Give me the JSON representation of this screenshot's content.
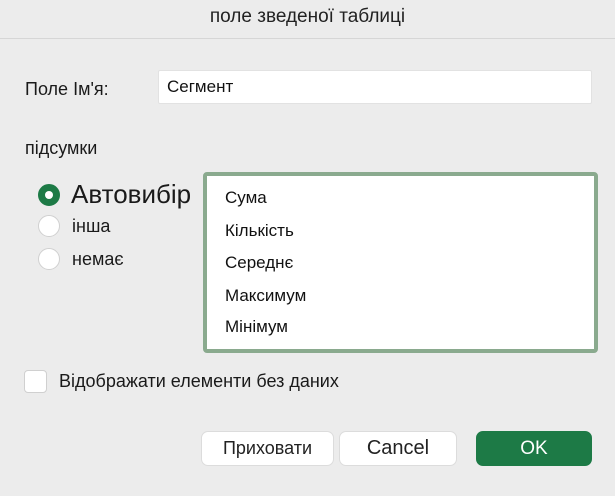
{
  "dialog": {
    "title": "поле зведеної таблиці"
  },
  "name_field": {
    "label": "Поле Ім'я:",
    "value": "Сегмент"
  },
  "subtotals": {
    "label": "підсумки",
    "options": [
      {
        "label": "Автовибір",
        "checked": true
      },
      {
        "label": "інша",
        "checked": false
      },
      {
        "label": "немає",
        "checked": false
      }
    ],
    "functions": [
      "Сума",
      "Кількість",
      "Середнє",
      "Максимум",
      "Мінімум"
    ]
  },
  "show_items_without_data": {
    "label": "Відображати елементи без даних",
    "checked": false
  },
  "buttons": {
    "hide": "Приховати",
    "cancel": "Cancel",
    "ok": "OK"
  },
  "colors": {
    "accent": "#1d7a46",
    "list_border": "#8aaa8e",
    "background": "#ececec"
  }
}
